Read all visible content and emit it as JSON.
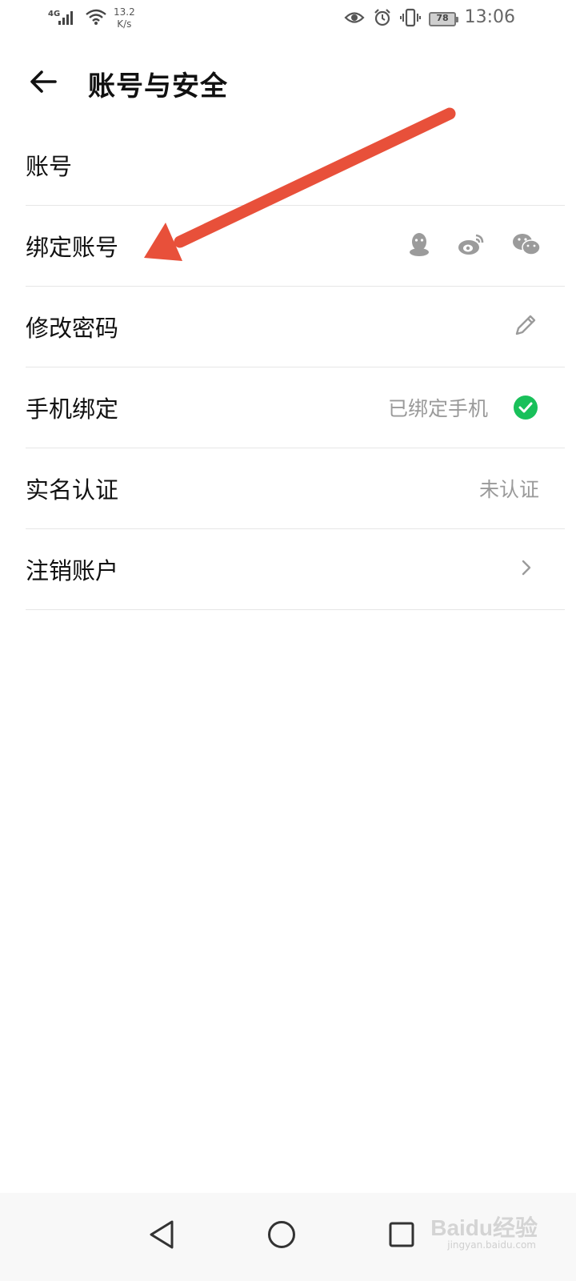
{
  "status_bar": {
    "network_type": "4G",
    "speed_value": "13.2",
    "speed_unit": "K/s",
    "battery": "78",
    "time": "13:06"
  },
  "header": {
    "title": "账号与安全",
    "back_icon": "back-arrow-icon"
  },
  "rows": [
    {
      "label": "账号"
    },
    {
      "label": "绑定账号",
      "icons": [
        "qq-icon",
        "weibo-icon",
        "wechat-icon"
      ]
    },
    {
      "label": "修改密码",
      "icon": "pencil-icon"
    },
    {
      "label": "手机绑定",
      "status": "已绑定手机",
      "icon": "check-circle-icon"
    },
    {
      "label": "实名认证",
      "status": "未认证"
    },
    {
      "label": "注销账户",
      "icon": "chevron-right-icon"
    }
  ],
  "colors": {
    "check": "#19c05a",
    "annotation_arrow": "#e8503a"
  },
  "watermark": {
    "text": "Baidu经验",
    "sub": "jingyan.baidu.com"
  }
}
